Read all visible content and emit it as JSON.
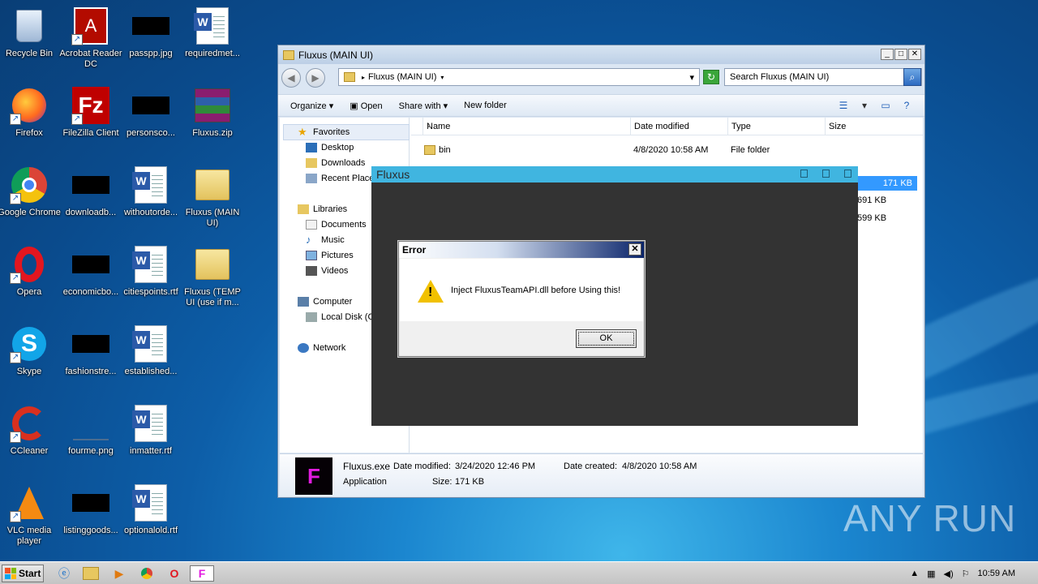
{
  "desktop": {
    "icons": [
      {
        "label": "Recycle Bin"
      },
      {
        "label": "Acrobat Reader DC"
      },
      {
        "label": "passpp.jpg"
      },
      {
        "label": "requiredmet..."
      },
      {
        "label": "Firefox"
      },
      {
        "label": "FileZilla Client"
      },
      {
        "label": "personsco..."
      },
      {
        "label": "Fluxus.zip"
      },
      {
        "label": "Google Chrome"
      },
      {
        "label": "downloadb..."
      },
      {
        "label": "withoutorde..."
      },
      {
        "label": "Fluxus (MAIN UI)"
      },
      {
        "label": "Opera"
      },
      {
        "label": "economicbo..."
      },
      {
        "label": "citiespoints.rtf"
      },
      {
        "label": "Fluxus (TEMP UI (use if m..."
      },
      {
        "label": "Skype"
      },
      {
        "label": "fashionstre..."
      },
      {
        "label": "established..."
      },
      {
        "label": "CCleaner"
      },
      {
        "label": "fourme.png"
      },
      {
        "label": "inmatter.rtf"
      },
      {
        "label": "VLC media player"
      },
      {
        "label": "listinggoods..."
      },
      {
        "label": "optionalold.rtf"
      }
    ]
  },
  "explorer": {
    "title": "Fluxus (MAIN UI)",
    "address": "Fluxus (MAIN UI)",
    "search_placeholder": "Search Fluxus (MAIN UI)",
    "toolbar": {
      "organize": "Organize",
      "open": "Open",
      "share_with": "Share with",
      "new_folder": "New folder"
    },
    "nav": {
      "favorites": "Favorites",
      "desktop": "Desktop",
      "downloads": "Downloads",
      "recent": "Recent Places",
      "libraries": "Libraries",
      "documents": "Documents",
      "music": "Music",
      "pictures": "Pictures",
      "videos": "Videos",
      "computer": "Computer",
      "local_disk": "Local Disk (C:)",
      "network": "Network"
    },
    "columns": {
      "name": "Name",
      "date": "Date modified",
      "type": "Type",
      "size": "Size"
    },
    "rows": [
      {
        "name": "bin",
        "date": "4/8/2020 10:58 AM",
        "type": "File folder",
        "size": ""
      }
    ],
    "partial_sizes": [
      "171 KB",
      "691 KB",
      "599 KB"
    ],
    "details": {
      "name": "Fluxus.exe",
      "date_modified_label": "Date modified:",
      "date_modified": "3/24/2020 12:46 PM",
      "date_created_label": "Date created:",
      "date_created": "4/8/2020 10:58 AM",
      "type": "Application",
      "size_label": "Size:",
      "size": "171 KB"
    }
  },
  "fluxus_window": {
    "title": "Fluxus"
  },
  "error_dialog": {
    "title": "Error",
    "message": "Inject FluxusTeamAPI.dll before Using this!",
    "ok": "OK"
  },
  "taskbar": {
    "start": "Start",
    "clock": "10:59 AM"
  },
  "watermark": "ANY RUN"
}
